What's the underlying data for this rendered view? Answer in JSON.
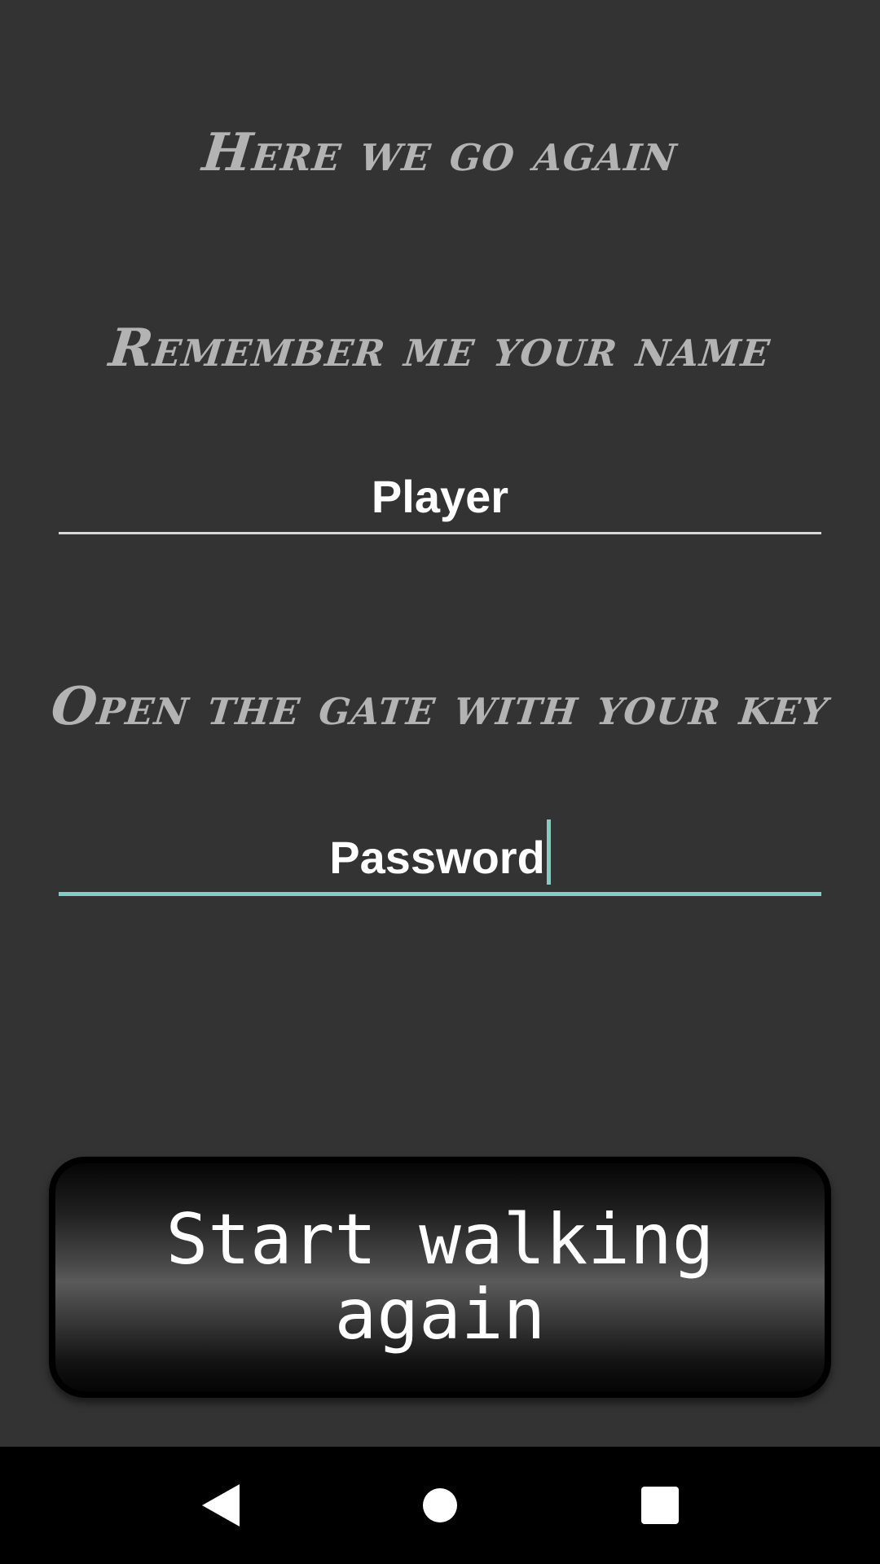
{
  "login": {
    "title": "Here we go again",
    "name_prompt": "Remember me your name",
    "name_value": "Player",
    "password_prompt": "Open the gate with your key",
    "password_value": "Password",
    "start_button": "Start walking again"
  },
  "navbar": {
    "back_icon": "back-triangle-icon",
    "home_icon": "home-circle-icon",
    "recents_icon": "recents-square-icon"
  },
  "colors": {
    "background": "#333333",
    "heading_text": "#b3b3b3",
    "accent": "#7fcdc4"
  }
}
